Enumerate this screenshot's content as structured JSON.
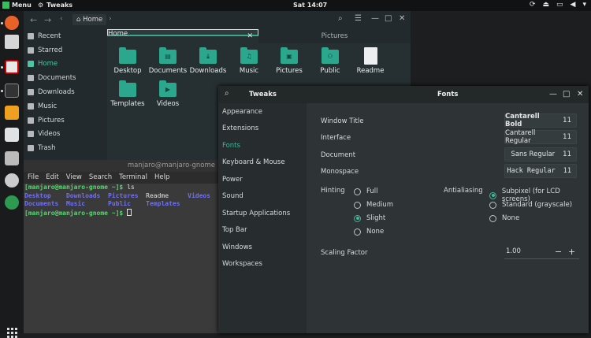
{
  "topbar": {
    "menu_label": "Menu",
    "app_label": "Tweaks",
    "clock": "Sat 14:07"
  },
  "file_manager": {
    "breadcrumb": "Home",
    "sidebar": [
      "Recent",
      "Starred",
      "Home",
      "Documents",
      "Downloads",
      "Music",
      "Pictures",
      "Videos",
      "Trash"
    ],
    "active_sidebar": "Home",
    "tabs": [
      "Home",
      "Pictures"
    ],
    "files": [
      "Desktop",
      "Documents",
      "Downloads",
      "Music",
      "Pictures",
      "Public",
      "Readme",
      "Templates",
      "Videos"
    ]
  },
  "terminal": {
    "title": "manjaro@manjaro-gnome",
    "menu": [
      "File",
      "Edit",
      "View",
      "Search",
      "Terminal",
      "Help"
    ],
    "prompt": "[manjaro@manjaro-gnome ~]$",
    "command": "ls",
    "ls_row1": [
      "Desktop",
      "Downloads",
      "Pictures",
      "Readme",
      "Videos"
    ],
    "ls_row2": [
      "Documents",
      "Music",
      "Public",
      "Templates"
    ]
  },
  "tweaks": {
    "title": "Tweaks",
    "page_title": "Fonts",
    "categories": [
      "Appearance",
      "Extensions",
      "Fonts",
      "Keyboard & Mouse",
      "Power",
      "Sound",
      "Startup Applications",
      "Top Bar",
      "Windows",
      "Workspaces"
    ],
    "selected_category": "Fonts",
    "fonts": {
      "window_title": {
        "label": "Window Title",
        "font": "Cantarell Bold",
        "size": "11"
      },
      "interface": {
        "label": "Interface",
        "font": "Cantarell Regular",
        "size": "11"
      },
      "document": {
        "label": "Document",
        "font": "Sans Regular",
        "size": "11"
      },
      "monospace": {
        "label": "Monospace",
        "font": "Hack Regular",
        "size": "11"
      }
    },
    "hinting": {
      "label": "Hinting",
      "options": [
        "Full",
        "Medium",
        "Slight",
        "None"
      ],
      "selected": "Slight"
    },
    "antialiasing": {
      "label": "Antialiasing",
      "options": [
        "Subpixel (for LCD screens)",
        "Standard (grayscale)",
        "None"
      ],
      "selected": "Subpixel (for LCD screens)"
    },
    "scaling": {
      "label": "Scaling Factor",
      "value": "1.00",
      "minus": "−",
      "plus": "+"
    }
  },
  "colors": {
    "accent": "#3fb89b",
    "folder": "#2aa78c",
    "terminal_green": "#54d86e",
    "terminal_blue": "#6f6ff5"
  }
}
